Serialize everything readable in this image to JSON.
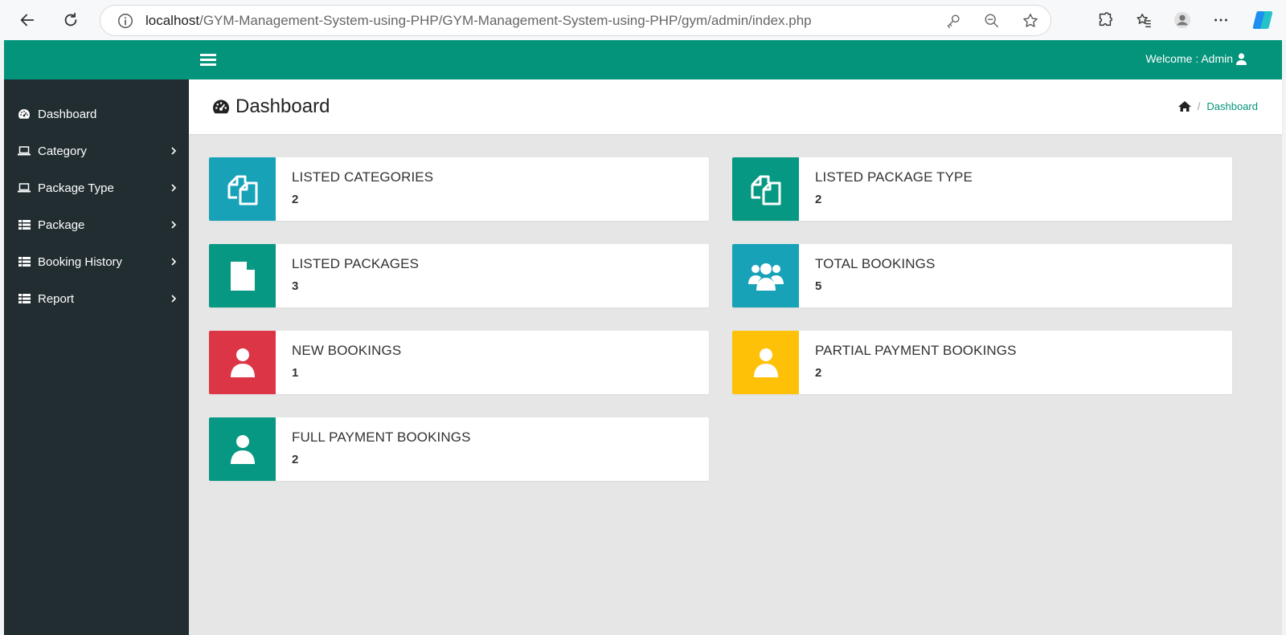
{
  "browser": {
    "url_host": "localhost",
    "url_path": "/GYM-Management-System-using-PHP/GYM-Management-System-using-PHP/gym/admin/index.php",
    "icons": [
      "back-icon",
      "reload-icon",
      "info-icon",
      "key-icon",
      "zoom-out-icon",
      "star-icon",
      "extensions-icon",
      "favorites-icon",
      "profile-icon",
      "more-icon",
      "copilot-icon"
    ]
  },
  "topbar": {
    "welcome_text": "Welcome : Admin",
    "color": "#03947b"
  },
  "sidebar": {
    "items": [
      {
        "label": "Dashboard",
        "icon": "dashboard-icon",
        "has_submenu": false
      },
      {
        "label": "Category",
        "icon": "laptop-icon",
        "has_submenu": true
      },
      {
        "label": "Package Type",
        "icon": "laptop-icon",
        "has_submenu": true
      },
      {
        "label": "Package",
        "icon": "list-icon",
        "has_submenu": true
      },
      {
        "label": "Booking History",
        "icon": "list-icon",
        "has_submenu": true
      },
      {
        "label": "Report",
        "icon": "list-icon",
        "has_submenu": true
      }
    ]
  },
  "header": {
    "title": "Dashboard",
    "breadcrumb": {
      "current": "Dashboard"
    }
  },
  "cards": [
    {
      "title": "LISTED CATEGORIES",
      "value": "2",
      "icon": "copy-icon",
      "color": "#17a2b8"
    },
    {
      "title": "LISTED PACKAGE TYPE",
      "value": "2",
      "icon": "copy-icon",
      "color": "#069882"
    },
    {
      "title": "LISTED PACKAGES",
      "value": "3",
      "icon": "file-icon",
      "color": "#069882"
    },
    {
      "title": "TOTAL BOOKINGS",
      "value": "5",
      "icon": "users-icon",
      "color": "#17a2b8"
    },
    {
      "title": "NEW BOOKINGS",
      "value": "1",
      "icon": "user-icon",
      "color": "#dc3545"
    },
    {
      "title": "PARTIAL PAYMENT BOOKINGS",
      "value": "2",
      "icon": "user-icon",
      "color": "#ffc107"
    },
    {
      "title": "FULL PAYMENT BOOKINGS",
      "value": "2",
      "icon": "user-icon",
      "color": "#069882"
    }
  ]
}
